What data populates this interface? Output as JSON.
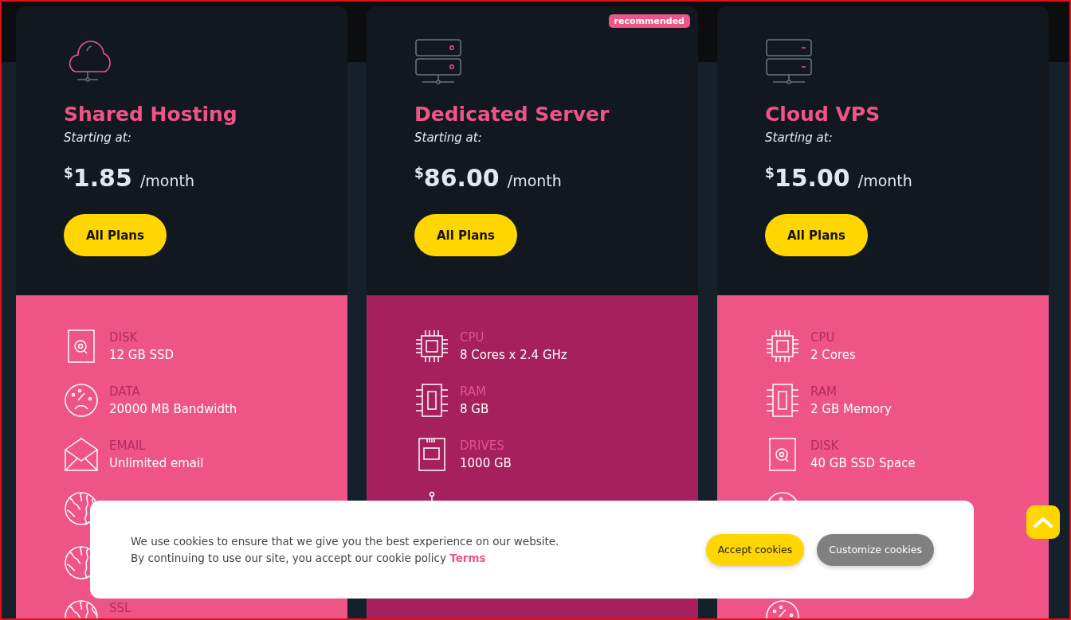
{
  "plans": [
    {
      "kind": "cloud",
      "title": "Shared Hosting",
      "subtitle": "Starting at:",
      "currency": "$",
      "price": "1.85",
      "period": "/month",
      "button": "All Plans",
      "featured": false,
      "features": [
        {
          "kind": "disk",
          "label": "DISK",
          "value": "12 GB SSD"
        },
        {
          "kind": "data",
          "label": "DATA",
          "value": "20000 MB Bandwidth"
        },
        {
          "kind": "email",
          "label": "EMAIL",
          "value": "Unlimited email"
        },
        {
          "kind": "globe"
        },
        {
          "kind": "globe"
        },
        {
          "kind": "globe",
          "label": "SSL"
        }
      ]
    },
    {
      "kind": "server",
      "title": "Dedicated Server",
      "subtitle": "Starting at:",
      "currency": "$",
      "price": "86.00",
      "period": "/month",
      "button": "All Plans",
      "featured": true,
      "badge": "recommended",
      "features": [
        {
          "kind": "cpu",
          "label": "CPU",
          "value": "8 Cores x 2.4 GHz"
        },
        {
          "kind": "ram",
          "label": "RAM",
          "value": "8 GB"
        },
        {
          "kind": "drive",
          "label": "DRIVES",
          "value": "1000 GB"
        },
        {
          "kind": "bandwidth"
        }
      ]
    },
    {
      "kind": "server-dash",
      "title": "Cloud VPS",
      "subtitle": "Starting at:",
      "currency": "$",
      "price": "15.00",
      "period": "/month",
      "button": "All Plans",
      "featured": false,
      "features": [
        {
          "kind": "cpu",
          "label": "CPU",
          "value": "2 Cores"
        },
        {
          "kind": "ram",
          "label": "RAM",
          "value": "2 GB Memory"
        },
        {
          "kind": "disk",
          "label": "DISK",
          "value": "40 GB SSD Space"
        },
        {
          "kind": "data"
        },
        {
          "kind": "blank"
        },
        {
          "kind": "data"
        }
      ]
    }
  ],
  "cookie_banner": {
    "lines": [
      "We use cookies to ensure that we give you the best experience on our website.",
      "By continuing to use our site, you accept our cookie policy"
    ],
    "link": "Terms",
    "accept_button": "Accept cookies",
    "customize_button": "Customize cookies"
  },
  "scroll_top_button": true
}
